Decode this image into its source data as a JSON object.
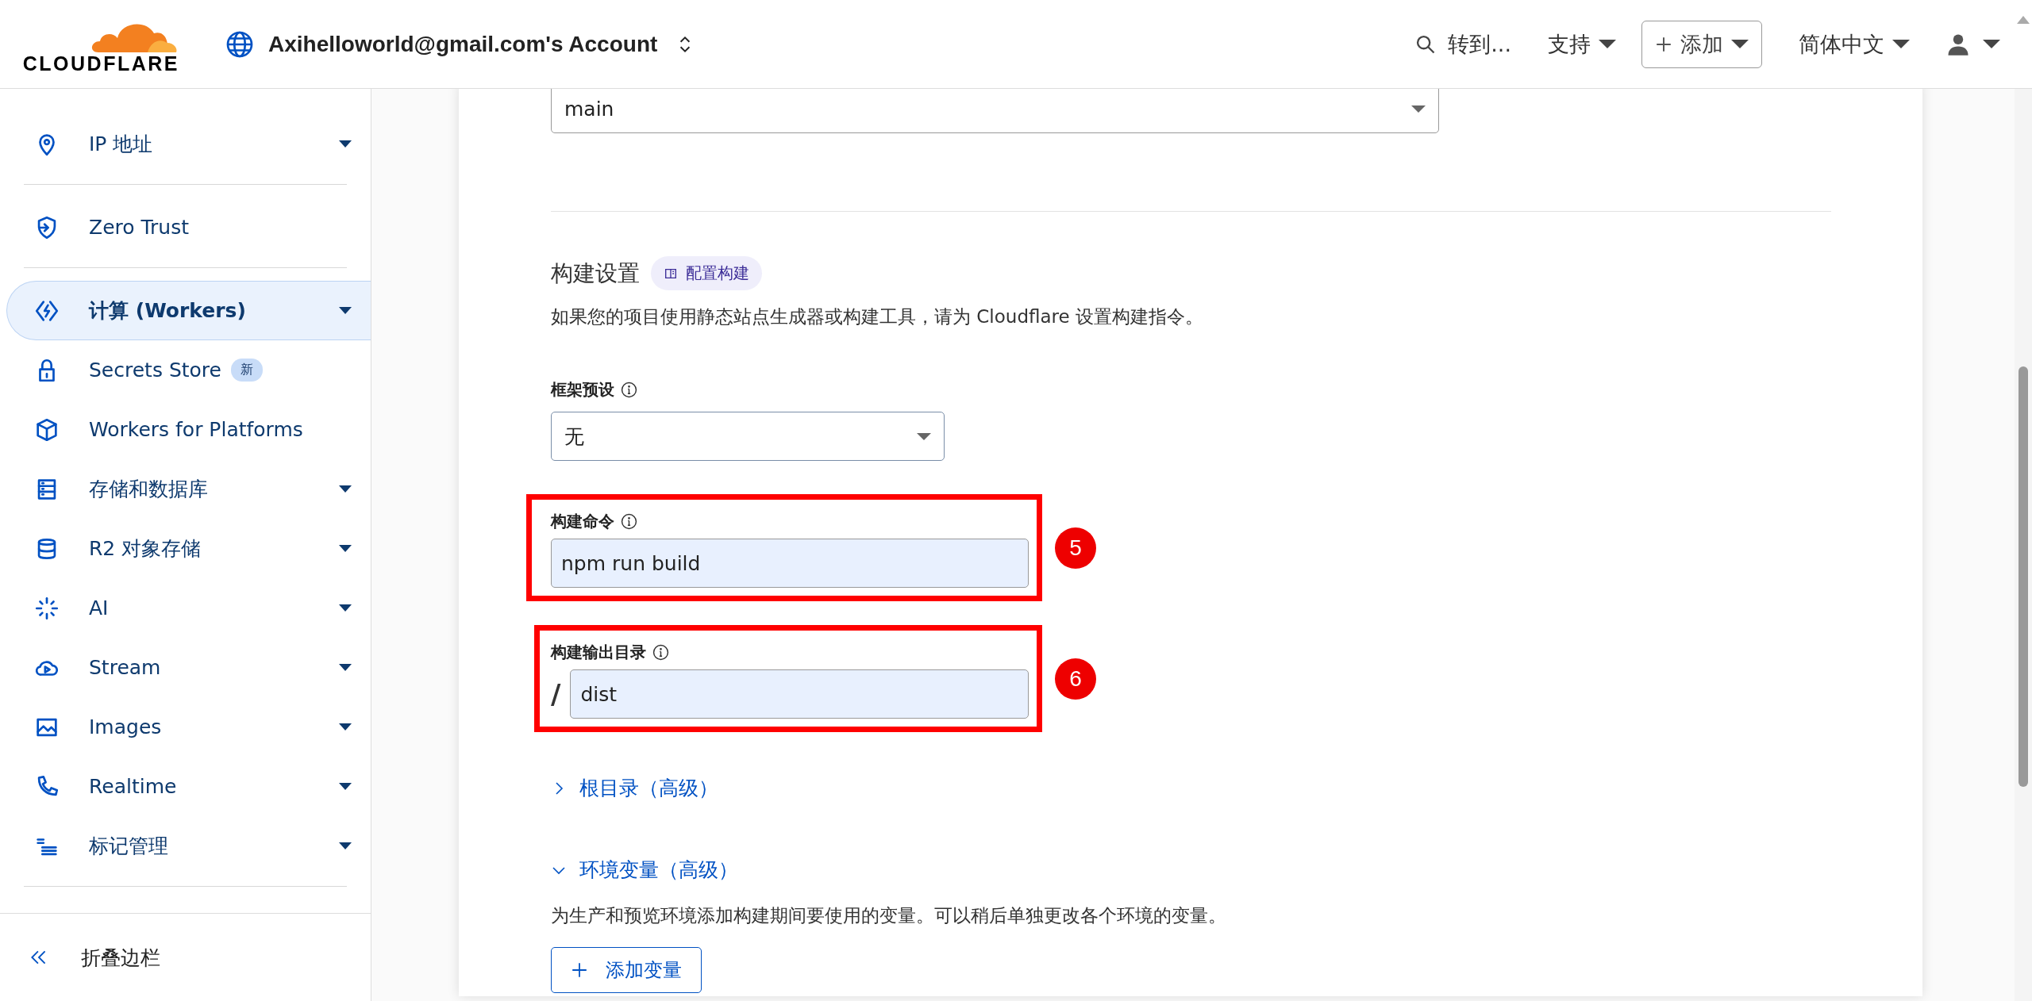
{
  "header": {
    "logo": "CLOUDFLARE",
    "account": "Axihelloworld@gmail.com's Account",
    "search": "转到...",
    "support": "支持",
    "add": "添加",
    "language": "简体中文"
  },
  "sidebar": {
    "groups": [
      [
        {
          "label": "IP 地址",
          "selected": false,
          "expandable": true
        }
      ],
      [
        {
          "label": "Zero Trust",
          "selected": false,
          "expandable": false
        }
      ],
      [
        {
          "label": "计算 (Workers)",
          "selected": true,
          "expandable": true
        },
        {
          "label": "Secrets Store",
          "selected": false,
          "expandable": false,
          "badge": "新"
        },
        {
          "label": "Workers for Platforms",
          "selected": false,
          "expandable": false
        },
        {
          "label": "存储和数据库",
          "selected": false,
          "expandable": true
        },
        {
          "label": "R2 对象存储",
          "selected": false,
          "expandable": true
        },
        {
          "label": "AI",
          "selected": false,
          "expandable": true
        },
        {
          "label": "Stream",
          "selected": false,
          "expandable": true
        },
        {
          "label": "Images",
          "selected": false,
          "expandable": true
        },
        {
          "label": "Realtime",
          "selected": false,
          "expandable": true
        },
        {
          "label": "标记管理",
          "selected": false,
          "expandable": true
        }
      ]
    ],
    "collapse": "折叠边栏"
  },
  "branch_select": {
    "value": "main"
  },
  "build": {
    "title": "构建设置",
    "doc_link": "配置构建",
    "description": "如果您的项目使用静态站点生成器或构建工具，请为 Cloudflare 设置构建指令。",
    "framework": {
      "label": "框架预设",
      "value": "无"
    },
    "command": {
      "label": "构建命令",
      "value": "npm run build",
      "annotation": "5"
    },
    "output": {
      "label": "构建输出目录",
      "prefix": "/",
      "value": "dist",
      "annotation": "6"
    },
    "root": {
      "label": "根目录（高级）",
      "expanded": false
    },
    "env": {
      "label": "环境变量（高级）",
      "expanded": true,
      "description": "为生产和预览环境添加构建期间要使用的变量。可以稍后单独更改各个环境的变量。",
      "add_button": "添加变量"
    }
  }
}
